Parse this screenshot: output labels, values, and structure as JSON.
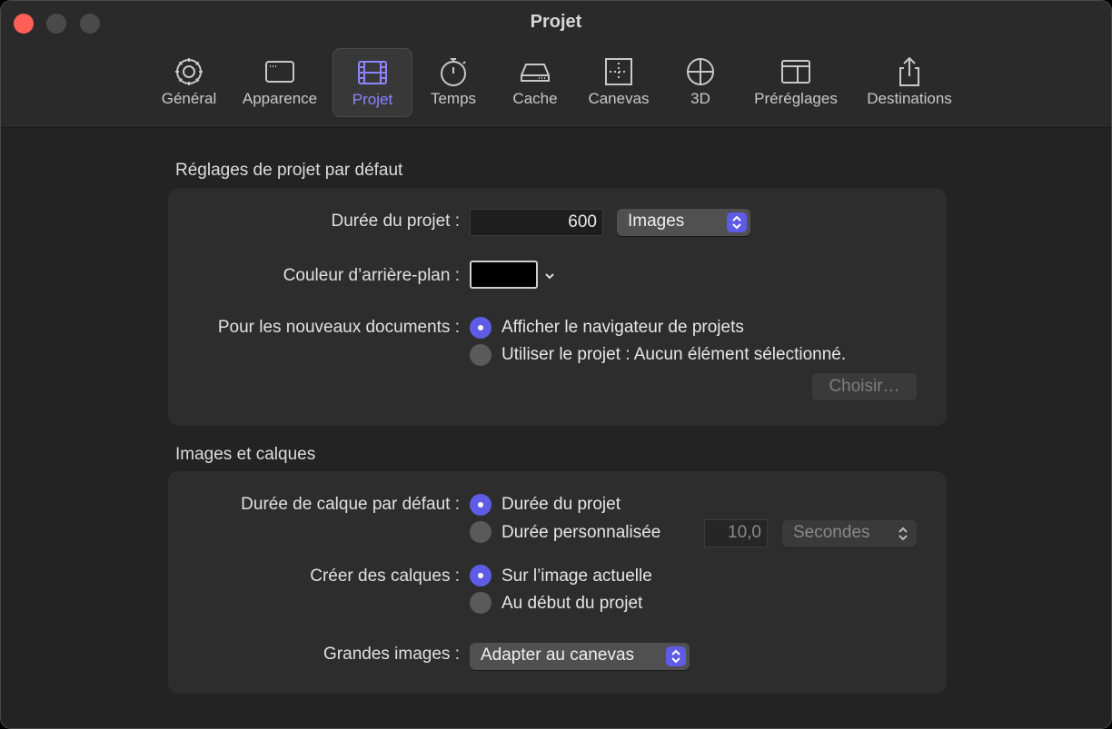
{
  "window": {
    "title": "Projet"
  },
  "toolbar": {
    "items": [
      {
        "label": "Général",
        "icon": "gear-icon"
      },
      {
        "label": "Apparence",
        "icon": "window-icon"
      },
      {
        "label": "Projet",
        "icon": "film-icon",
        "selected": true
      },
      {
        "label": "Temps",
        "icon": "stopwatch-icon"
      },
      {
        "label": "Cache",
        "icon": "drive-icon"
      },
      {
        "label": "Canevas",
        "icon": "canvas-icon"
      },
      {
        "label": "3D",
        "icon": "sphere-icon"
      },
      {
        "label": "Préréglages",
        "icon": "presets-icon"
      },
      {
        "label": "Destinations",
        "icon": "share-icon"
      }
    ]
  },
  "project_defaults": {
    "title": "Réglages de projet par défaut",
    "duration_label": "Durée du projet :",
    "duration_value": "600",
    "duration_unit": "Images",
    "bg_color_label": "Couleur d’arrière-plan :",
    "new_docs_label": "Pour les nouveaux documents :",
    "option_browser": "Afficher le navigateur de projets",
    "option_use_project": "Utiliser le projet : Aucun élément sélectionné.",
    "choose_button": "Choisir…"
  },
  "images_layers": {
    "title": "Images et calques",
    "layer_duration_label": "Durée de calque par défaut :",
    "option_project_duration": "Durée du projet",
    "option_custom_duration": "Durée personnalisée",
    "custom_value": "10,0",
    "custom_unit": "Secondes",
    "create_layers_label": "Créer des calques :",
    "option_current_frame": "Sur l’image actuelle",
    "option_project_start": "Au début du projet",
    "large_images_label": "Grandes images :",
    "large_images_value": "Adapter au canevas"
  },
  "colors": {
    "accent": "#5e5ce6",
    "close": "#ff5f57"
  }
}
